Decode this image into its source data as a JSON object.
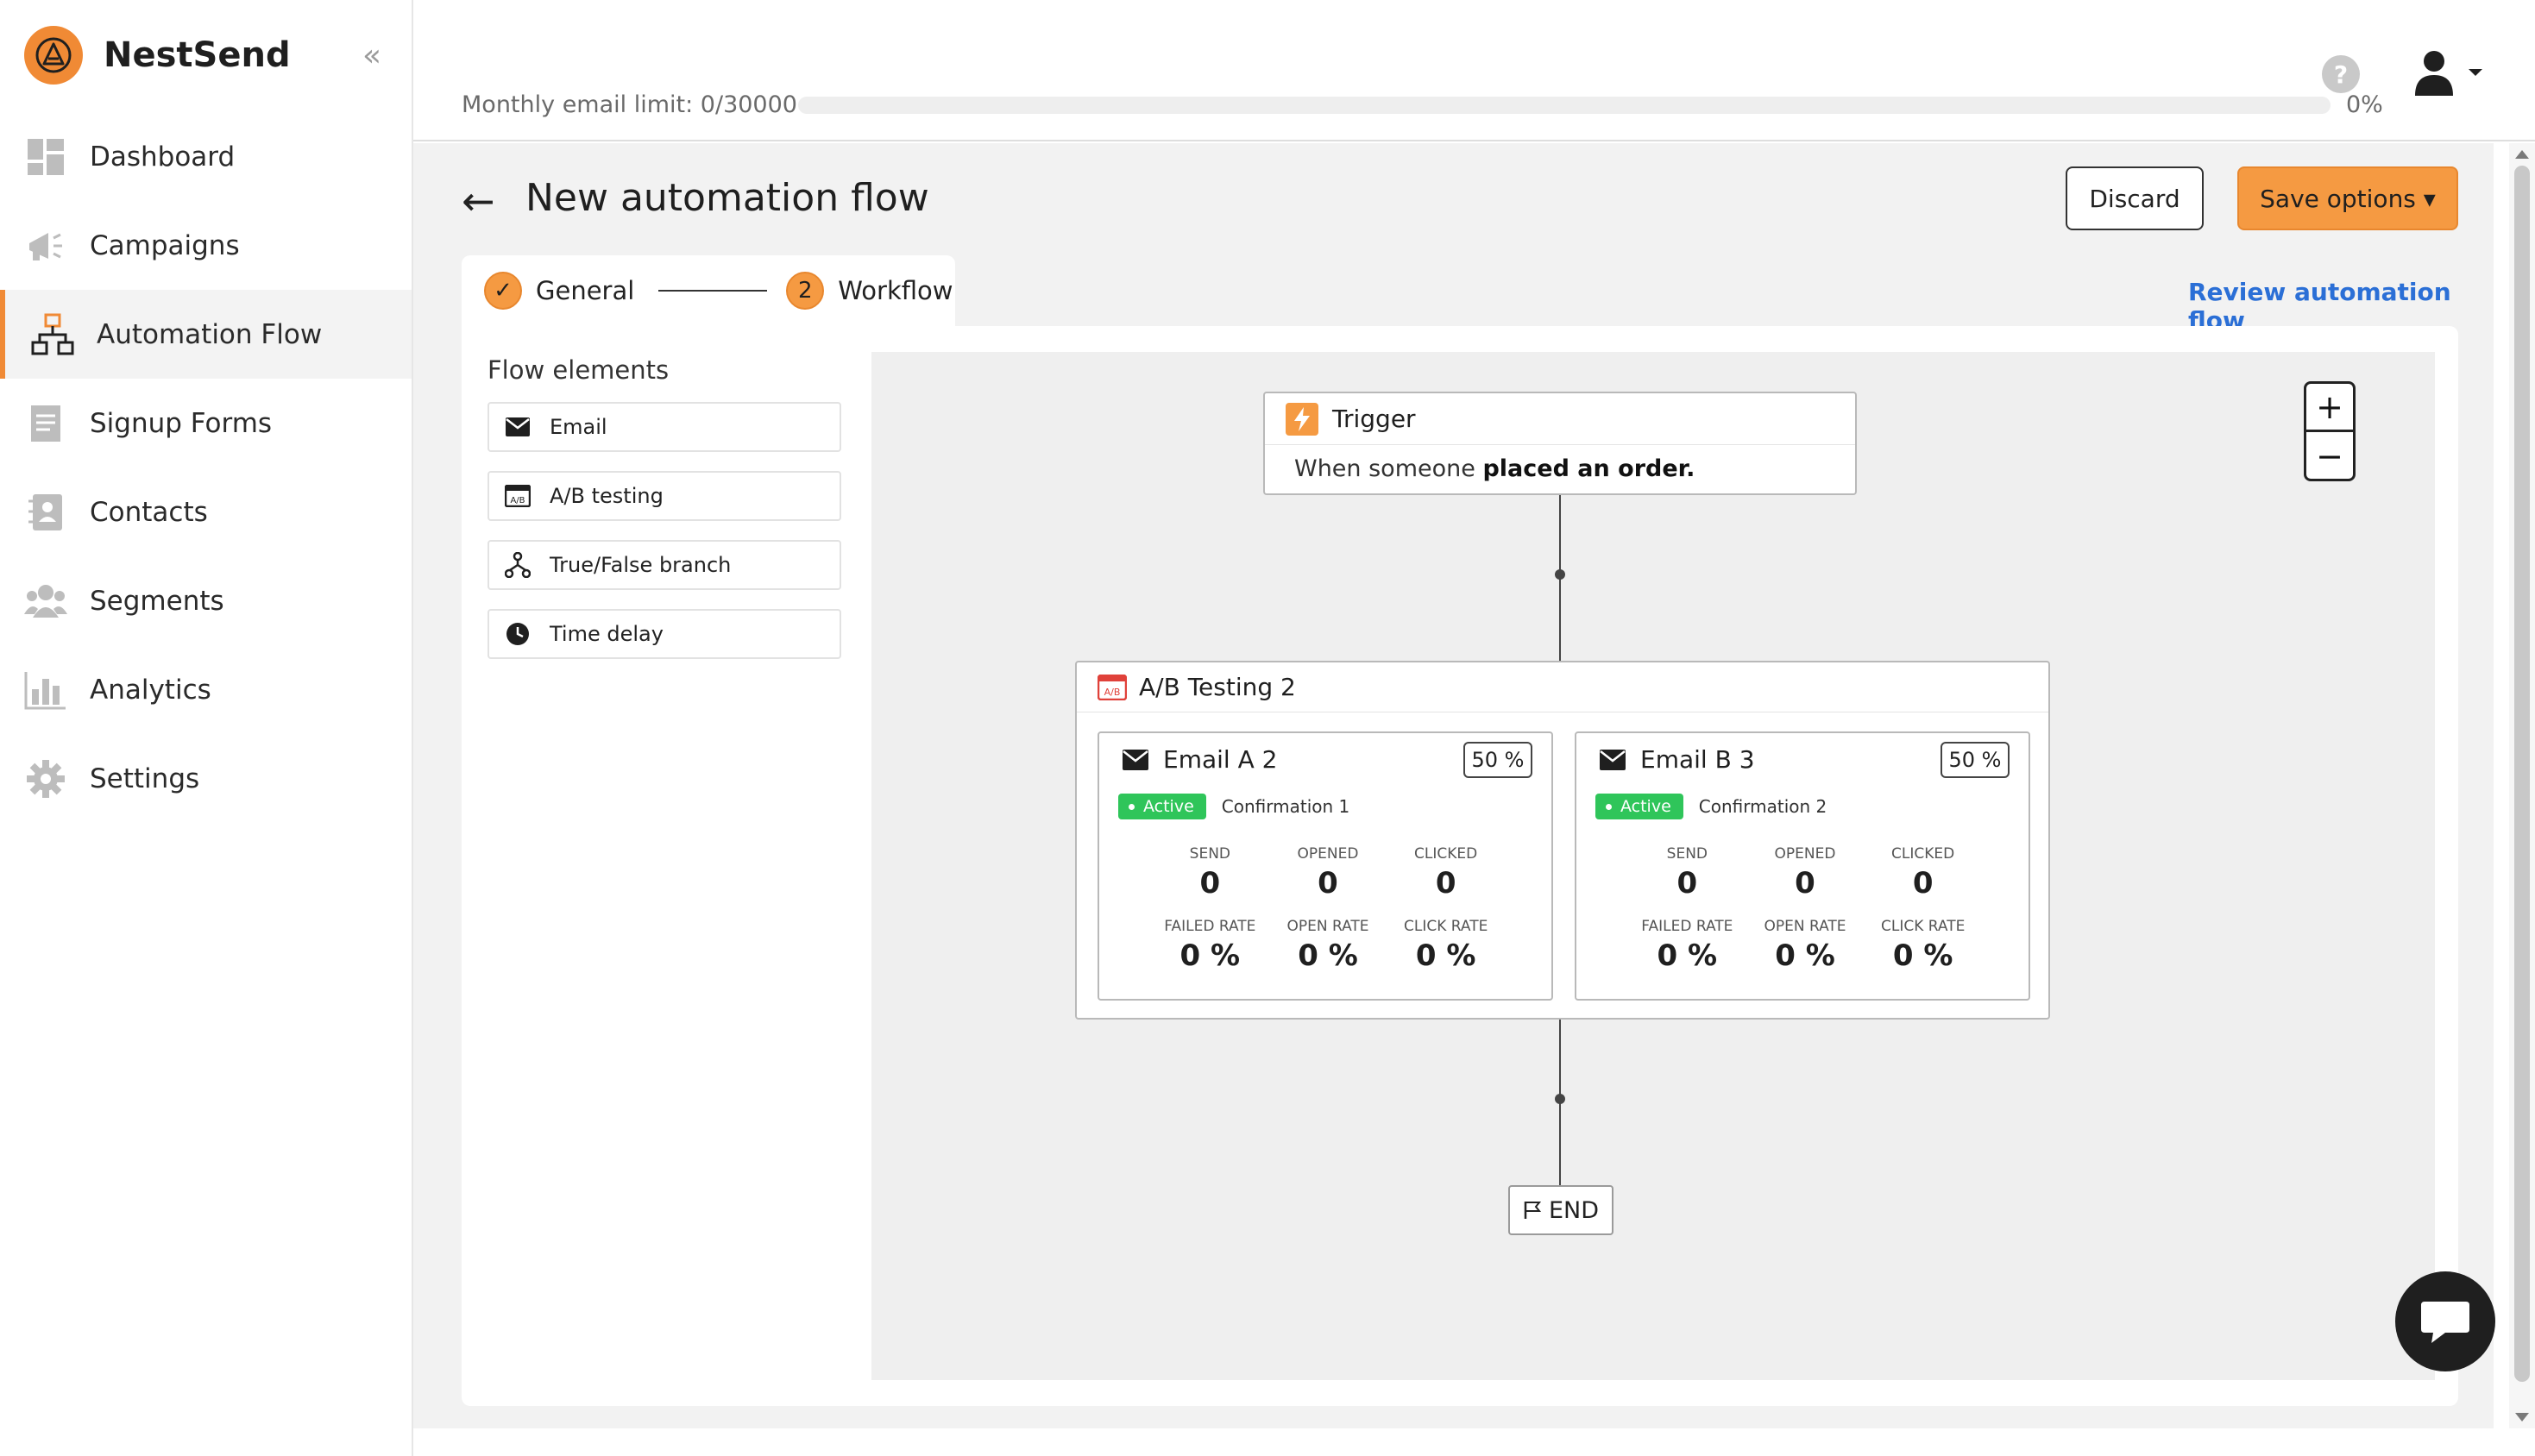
{
  "brand": {
    "name": "NestSend"
  },
  "sidebar": {
    "collapse_glyph": "«",
    "items": [
      {
        "label": "Dashboard"
      },
      {
        "label": "Campaigns"
      },
      {
        "label": "Automation Flow"
      },
      {
        "label": "Signup Forms"
      },
      {
        "label": "Contacts"
      },
      {
        "label": "Segments"
      },
      {
        "label": "Analytics"
      },
      {
        "label": "Settings"
      }
    ],
    "active_index": 2
  },
  "topbar": {
    "limit_text": "Monthly email limit: 0/30000",
    "limit_percent": "0%",
    "limit_fraction": 0,
    "help_glyph": "?"
  },
  "page": {
    "back_glyph": "←",
    "title": "New automation flow",
    "discard_label": "Discard",
    "save_label": "Save options ▾",
    "review_link": "Review automation flow"
  },
  "steps": [
    {
      "label": "General",
      "marker": "✓"
    },
    {
      "label": "Workflow",
      "marker": "2"
    }
  ],
  "flow_elements": {
    "title": "Flow elements",
    "items": [
      {
        "label": "Email"
      },
      {
        "label": "A/B testing"
      },
      {
        "label": "True/False branch"
      },
      {
        "label": "Time delay"
      }
    ]
  },
  "canvas": {
    "zoom_in": "+",
    "zoom_out": "−",
    "trigger": {
      "title": "Trigger",
      "desc_prefix": "When someone ",
      "desc_bold": "placed an order."
    },
    "ab_test": {
      "title": "A/B Testing 2",
      "emails": [
        {
          "title": "Email A 2",
          "split": "50 %",
          "status": "Active",
          "name": "Confirmation 1",
          "stats": [
            {
              "label": "SEND",
              "value": "0"
            },
            {
              "label": "OPENED",
              "value": "0"
            },
            {
              "label": "CLICKED",
              "value": "0"
            },
            {
              "label": "FAILED RATE",
              "value": "0 %"
            },
            {
              "label": "OPEN RATE",
              "value": "0 %"
            },
            {
              "label": "CLICK RATE",
              "value": "0 %"
            }
          ]
        },
        {
          "title": "Email B 3",
          "split": "50 %",
          "status": "Active",
          "name": "Confirmation 2",
          "stats": [
            {
              "label": "SEND",
              "value": "0"
            },
            {
              "label": "OPENED",
              "value": "0"
            },
            {
              "label": "CLICKED",
              "value": "0"
            },
            {
              "label": "FAILED RATE",
              "value": "0 %"
            },
            {
              "label": "OPEN RATE",
              "value": "0 %"
            },
            {
              "label": "CLICK RATE",
              "value": "0 %"
            }
          ]
        }
      ]
    },
    "end_label": "END"
  },
  "colors": {
    "accent": "#f59a42",
    "link": "#2b6fd6",
    "active_badge": "#2fc55a"
  }
}
